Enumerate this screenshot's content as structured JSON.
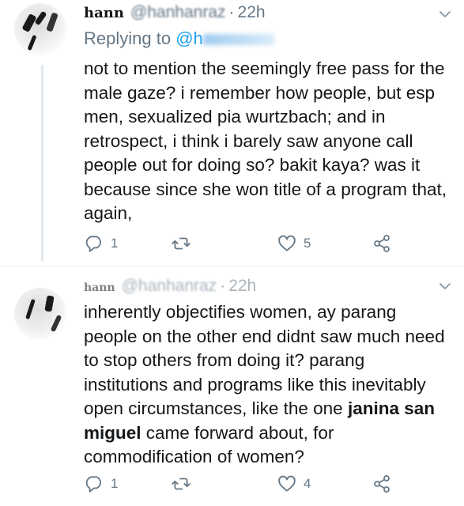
{
  "tweets": [
    {
      "display_name": "hann",
      "handle": "@hanhanraz",
      "dot": "·",
      "time": "22h",
      "replying_prefix": "Replying to ",
      "replying_handle": "@h",
      "text": "not to mention the seemingly free pass for the male gaze? i remember how people, but esp men, sexualized pia wurtzbach; and in retrospect, i think i barely saw anyone call people out for doing so? bakit kaya? was it because since she won title of a program that, again,",
      "actions": {
        "reply_count": "1",
        "retweet_count": "",
        "like_count": "5"
      },
      "icons": [
        "reply-icon",
        "retweet-icon",
        "like-icon",
        "share-icon",
        "chevron-down-icon"
      ]
    },
    {
      "display_name": "hann",
      "handle": "@hanhanraz",
      "dot": "·",
      "time": "22h",
      "text_before": "inherently objectifies women, ay parang people on the other end didnt saw much need to stop others from doing it? parang institutions and programs like this inevitably open circumstances, like the one ",
      "text_bold": "janina san miguel",
      "text_after": " came forward about, for commodification of  women?",
      "actions": {
        "reply_count": "1",
        "retweet_count": "",
        "like_count": "4"
      },
      "icons": [
        "reply-icon",
        "retweet-icon",
        "like-icon",
        "share-icon",
        "chevron-down-icon"
      ]
    }
  ],
  "colors": {
    "text": "#14171a",
    "secondary": "#657786",
    "link": "#1da1f2",
    "thread": "#e1e8ed"
  }
}
